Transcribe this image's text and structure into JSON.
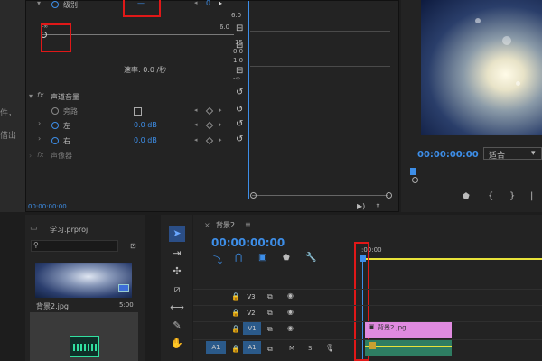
{
  "document_strip": {
    "line1": "件，",
    "line2": "借出"
  },
  "effect_controls": {
    "level_label": "级别",
    "level_value": "0",
    "scale_top": "6.0",
    "scale_mid_top": "-∞",
    "level_curve_value": "6.0",
    "scale_15": "15",
    "scale_0": "0.0",
    "scale_10": "1.0",
    "scale_neg": "-∞",
    "rate_label": "速率: 0.0 /秒",
    "channel_volume_label": "声道音量",
    "bypass_label": "旁路",
    "left_label": "左",
    "left_value": "0.0 dB",
    "right_label": "右",
    "right_value": "0.0 dB",
    "panner_label": "声像器",
    "fx_badge": "fx",
    "timecode": "00:00:00:00"
  },
  "program_monitor": {
    "timecode": "00:00:00:00",
    "fit_label": "适合",
    "fit_arrow": "▾"
  },
  "project_panel": {
    "project_name": "学习.prproj",
    "search_placeholder": "",
    "clip_name": "背景2.jpg",
    "clip_duration": "5:00"
  },
  "timeline": {
    "sequence_name": "背景2",
    "timecode": "00:00:00:00",
    "ruler_start": ":00:00",
    "tracks": [
      {
        "name": "V3"
      },
      {
        "name": "V2"
      },
      {
        "name": "V1"
      },
      {
        "name": "A1",
        "source": "A1",
        "m": "M",
        "s": "S"
      }
    ],
    "clip_label": "背景2.jpg"
  },
  "colors": {
    "accent_blue": "#3d8ee8",
    "annotation_red": "#e01818",
    "playhead_yellow": "#e8e23a",
    "video_clip": "#e08ae0",
    "audio_clip": "#2e7d62"
  }
}
